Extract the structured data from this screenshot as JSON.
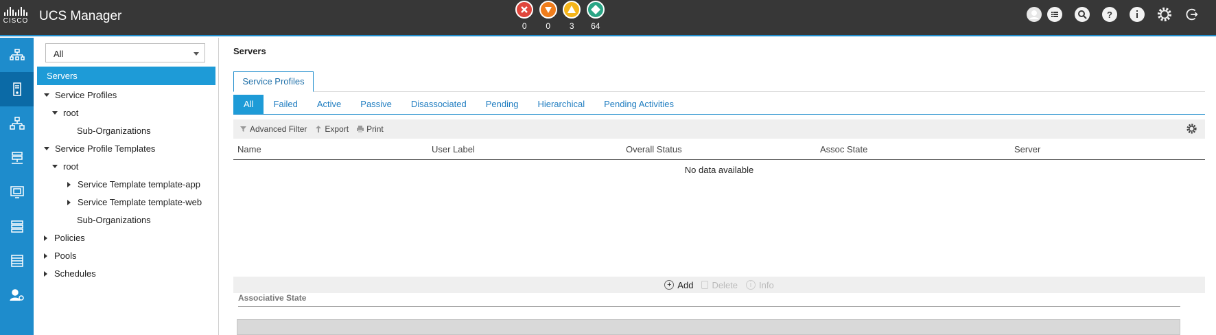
{
  "header": {
    "logo_text": "CISCO",
    "title": "UCS Manager",
    "faults": [
      {
        "name": "critical",
        "count": "0",
        "color": "#e0463c"
      },
      {
        "name": "major",
        "count": "0",
        "color": "#f07d1c"
      },
      {
        "name": "minor",
        "count": "3",
        "color": "#f5b51a"
      },
      {
        "name": "warning",
        "count": "64",
        "color": "#2aa585"
      }
    ],
    "icons": [
      "user-icon",
      "list-icon",
      "search-icon",
      "help-icon",
      "info-icon",
      "settings-icon",
      "logout-icon"
    ]
  },
  "leftnav": {
    "items": [
      "equipment-icon",
      "servers-icon",
      "lan-icon",
      "san-icon",
      "vm-icon",
      "storage-icon",
      "chassis-icon",
      "admin-icon"
    ],
    "active_index": 1,
    "accent": "#1e8ccc"
  },
  "tree": {
    "filter_value": "All",
    "items": [
      {
        "label": "Servers",
        "level": 0,
        "toggle": "none",
        "selected": true
      },
      {
        "label": "Service Profiles",
        "level": 1,
        "toggle": "down"
      },
      {
        "label": "root",
        "level": 2,
        "toggle": "down"
      },
      {
        "label": "Sub-Organizations",
        "level": 3,
        "toggle": "none"
      },
      {
        "label": "Service Profile Templates",
        "level": 1,
        "toggle": "down"
      },
      {
        "label": "root",
        "level": 2,
        "toggle": "down"
      },
      {
        "label": "Service Template template-app",
        "level": 3,
        "toggle": "right"
      },
      {
        "label": "Service Template template-web",
        "level": 3,
        "toggle": "right"
      },
      {
        "label": "Sub-Organizations",
        "level": 3,
        "toggle": "none"
      },
      {
        "label": "Policies",
        "level": 1,
        "toggle": "right"
      },
      {
        "label": "Pools",
        "level": 1,
        "toggle": "right"
      },
      {
        "label": "Schedules",
        "level": 1,
        "toggle": "right"
      }
    ]
  },
  "main": {
    "title": "Servers",
    "outer_tab": "Service Profiles",
    "subtabs": [
      "All",
      "Failed",
      "Active",
      "Passive",
      "Disassociated",
      "Pending",
      "Hierarchical",
      "Pending Activities"
    ],
    "active_subtab": 0,
    "toolbar": {
      "advanced_filter": "Advanced Filter",
      "export": "Export",
      "print": "Print"
    },
    "columns": [
      "Name",
      "User Label",
      "Overall Status",
      "Assoc State",
      "Server"
    ],
    "empty_text": "No data available",
    "actions": {
      "add": "Add",
      "delete": "Delete",
      "info": "Info"
    },
    "section_title": "Associative State"
  }
}
